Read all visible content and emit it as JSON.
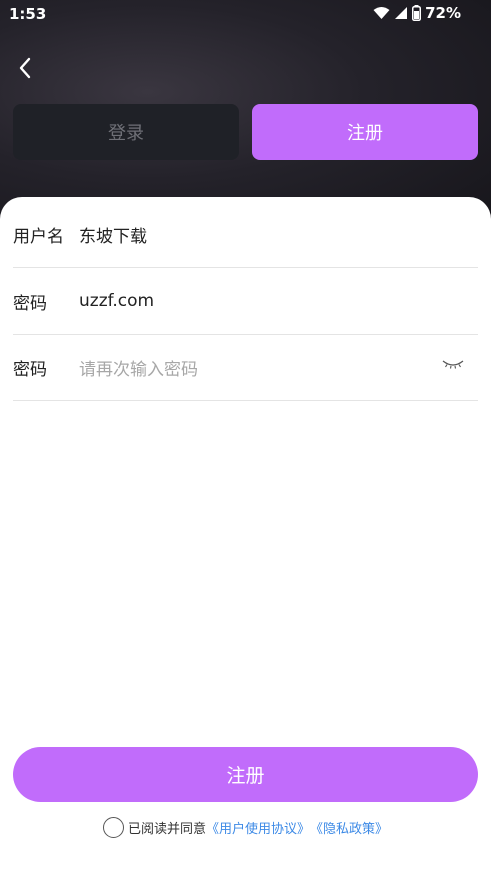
{
  "status_bar": {
    "time": "1:53",
    "battery": "72%"
  },
  "tabs": {
    "login": "登录",
    "register": "注册"
  },
  "form": {
    "username_label": "用户名",
    "username_value": "东坡下载",
    "password_label": "密码",
    "password_value": "uzzf.com",
    "confirm_label": "密码",
    "confirm_placeholder": "请再次输入密码"
  },
  "submit": {
    "label": "注册"
  },
  "agreement": {
    "prefix": "已阅读并同意",
    "user_agreement": "《用户使用协议》",
    "privacy_policy": "《隐私政策》"
  },
  "colors": {
    "accent": "#c16cfb",
    "link": "#3d8ae6",
    "dark_tab": "#1f2127"
  },
  "icons": [
    "back-icon",
    "wifi-icon",
    "signal-icon",
    "battery-icon",
    "eye-closed-icon"
  ]
}
